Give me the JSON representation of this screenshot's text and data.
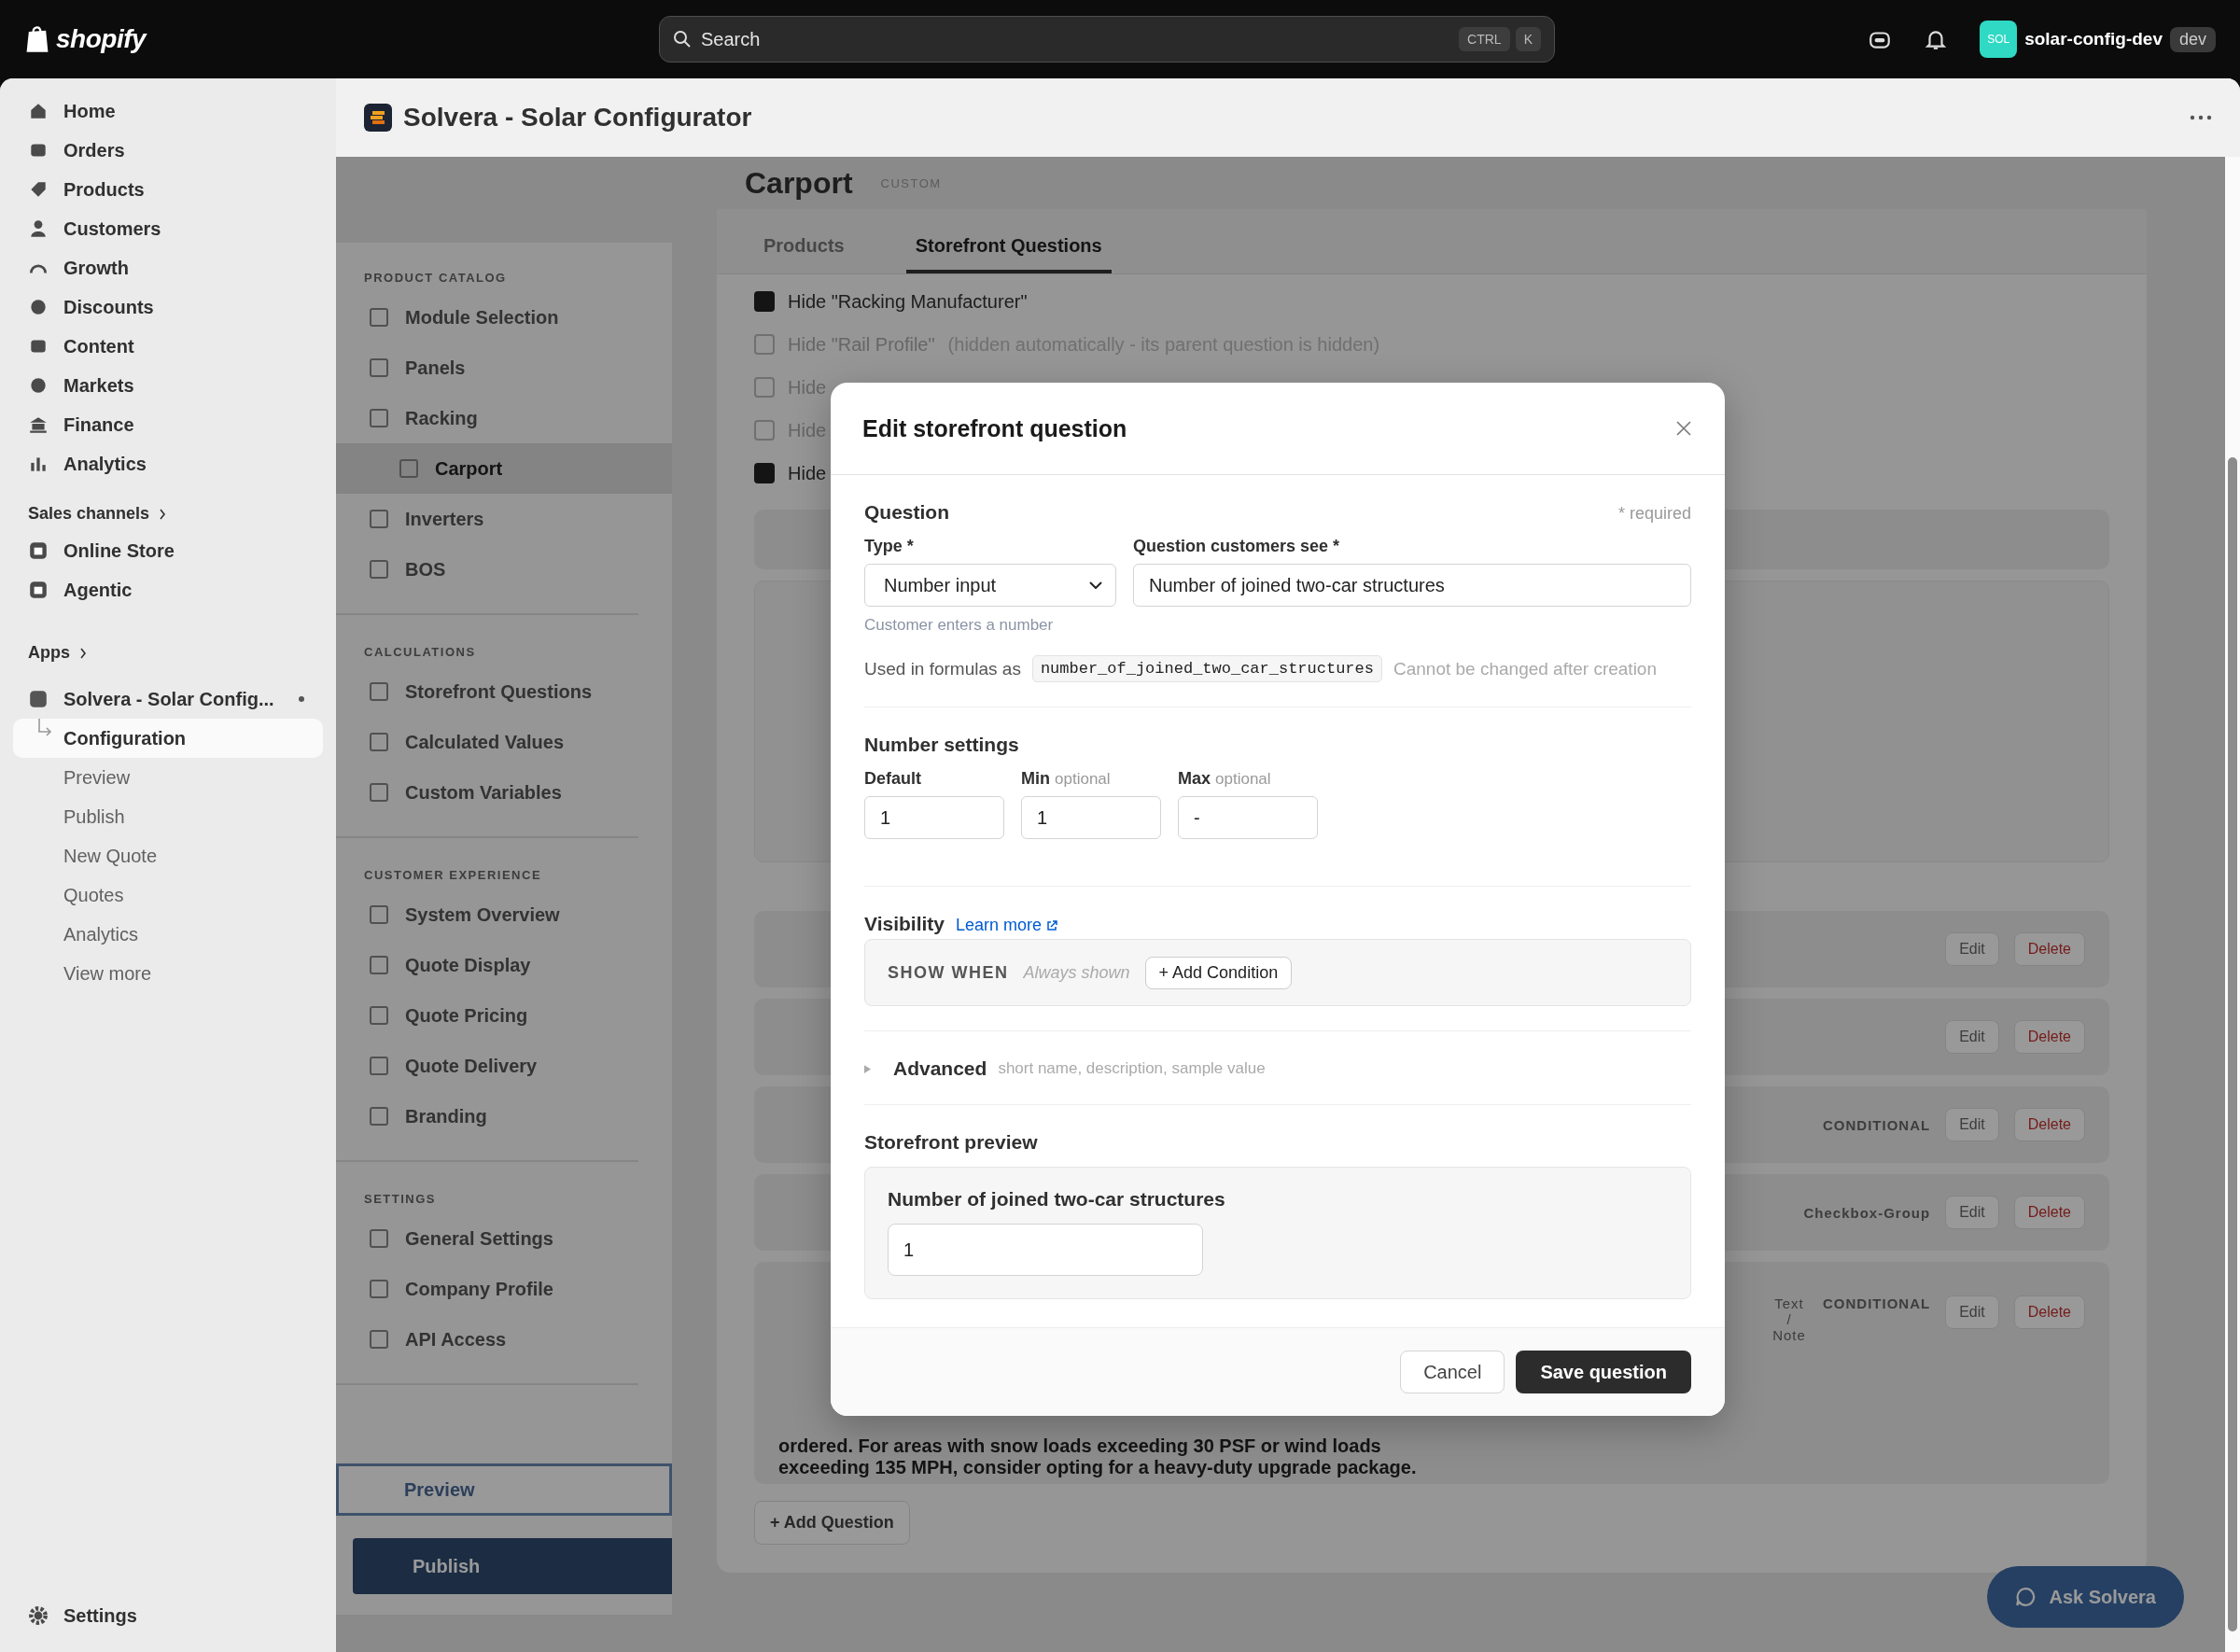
{
  "topbar": {
    "logo": "shopify",
    "search": {
      "placeholder": "Search",
      "keys": [
        "CTRL",
        "K"
      ]
    },
    "store": {
      "avatar": "SOL",
      "name": "solar-config-dev",
      "badge": "dev"
    }
  },
  "sidebar": {
    "items": [
      {
        "label": "Home",
        "selected": false
      },
      {
        "label": "Orders",
        "selected": false
      },
      {
        "label": "Products",
        "selected": false
      },
      {
        "label": "Customers",
        "selected": false
      },
      {
        "label": "Growth",
        "selected": false
      },
      {
        "label": "Discounts",
        "selected": false
      },
      {
        "label": "Content",
        "selected": false
      },
      {
        "label": "Markets",
        "selected": false
      },
      {
        "label": "Finance",
        "selected": false
      },
      {
        "label": "Analytics",
        "selected": false
      }
    ],
    "sales_channels": {
      "label": "Sales channels",
      "items": [
        "Online Store",
        "Agentic"
      ]
    },
    "apps": {
      "label": "Apps",
      "app": {
        "label": "Solvera - Solar Config...",
        "children": [
          {
            "label": "Configuration",
            "selected": true
          },
          {
            "label": "Preview",
            "selected": false
          },
          {
            "label": "Publish",
            "selected": false
          },
          {
            "label": "New Quote",
            "selected": false
          },
          {
            "label": "Quotes",
            "selected": false
          },
          {
            "label": "Analytics",
            "selected": false
          },
          {
            "label": "View more",
            "selected": false
          }
        ]
      }
    },
    "settings": "Settings"
  },
  "page_header": {
    "title": "Solvera - Solar Configurator"
  },
  "app_nav": {
    "sections": [
      {
        "heading": "PRODUCT CATALOG",
        "items": [
          {
            "label": "Module Selection",
            "selected": false
          },
          {
            "label": "Panels",
            "selected": false
          },
          {
            "label": "Racking",
            "selected": false,
            "expanded": true,
            "children": [
              {
                "label": "Carport",
                "selected": true
              }
            ]
          },
          {
            "label": "Inverters",
            "selected": false
          },
          {
            "label": "BOS",
            "selected": false
          }
        ]
      },
      {
        "heading": "CALCULATIONS",
        "items": [
          {
            "label": "Storefront Questions",
            "selected": false
          },
          {
            "label": "Calculated Values",
            "selected": false
          },
          {
            "label": "Custom Variables",
            "selected": false
          }
        ]
      },
      {
        "heading": "CUSTOMER EXPERIENCE",
        "items": [
          {
            "label": "System Overview",
            "selected": false
          },
          {
            "label": "Quote Display",
            "selected": false
          },
          {
            "label": "Quote Pricing",
            "selected": false
          },
          {
            "label": "Quote Delivery",
            "selected": false
          },
          {
            "label": "Branding",
            "selected": false
          }
        ]
      },
      {
        "heading": "SETTINGS",
        "items": [
          {
            "label": "General Settings",
            "selected": false
          },
          {
            "label": "Company Profile",
            "selected": false
          },
          {
            "label": "API Access",
            "selected": false
          }
        ]
      }
    ],
    "preview_button": "Preview",
    "publish_button": "Publish"
  },
  "editor": {
    "title": "Carport",
    "badge": "CUSTOM",
    "tabs": [
      {
        "label": "Products",
        "selected": false
      },
      {
        "label": "Storefront Questions",
        "selected": true
      }
    ],
    "hide_options": [
      {
        "label": "Hide \"Racking Manufacturer\"",
        "checked": true,
        "disabled": false
      },
      {
        "label": "Hide \"Rail Profile\"",
        "note": "(hidden automatically - its parent question is hidden)",
        "checked": false,
        "disabled": true
      },
      {
        "label": "Hide",
        "checked": false,
        "disabled": true
      },
      {
        "label": "Hide",
        "checked": false,
        "disabled": true
      },
      {
        "label": "Hide",
        "checked": true,
        "disabled": false
      }
    ],
    "questions": [
      {
        "edit": "Edit",
        "delete": "Delete"
      },
      {
        "edit": "Edit",
        "delete": "Delete"
      },
      {
        "tags": [
          "CONDITIONAL"
        ],
        "edit": "Edit",
        "delete": "Delete"
      },
      {
        "tags": [
          "Checkbox-Group"
        ],
        "edit": "Edit",
        "delete": "Delete"
      },
      {
        "tags": [
          "Text / Note",
          "CONDITIONAL"
        ],
        "edit": "Edit",
        "delete": "Delete",
        "text": "ordered. For areas with snow loads exceeding 30 PSF or wind loads exceeding 135 MPH, consider opting for a heavy-duty upgrade package."
      }
    ],
    "add_question": "+ Add Question"
  },
  "chat_button": "Ask Solvera",
  "modal": {
    "title": "Edit storefront question",
    "question": {
      "heading": "Question",
      "required_note": "* required",
      "type": {
        "label": "Type *",
        "value": "Number input",
        "hint": "Customer enters a number"
      },
      "text": {
        "label": "Question customers see *",
        "value": "Number of joined two-car structures"
      },
      "formula": {
        "label": "Used in formulas as",
        "code": "number_of_joined_two_car_structures",
        "note": "Cannot be changed after creation"
      }
    },
    "number_settings": {
      "heading": "Number settings",
      "fields": [
        {
          "label": "Default",
          "value": "1"
        },
        {
          "label": "Min",
          "optional": "optional",
          "value": "1"
        },
        {
          "label": "Max",
          "optional": "optional",
          "value": "-"
        }
      ]
    },
    "visibility": {
      "heading": "Visibility",
      "link": "Learn more",
      "show_when": "SHOW WHEN",
      "condition": "Always shown",
      "add_button": "+ Add Condition"
    },
    "advanced": {
      "label": "Advanced",
      "hint": "short name, description, sample value",
      "expanded": false
    },
    "preview": {
      "heading": "Storefront preview",
      "question": "Number of joined two-car structures",
      "value": "1"
    },
    "cancel": "Cancel",
    "save": "Save question"
  }
}
